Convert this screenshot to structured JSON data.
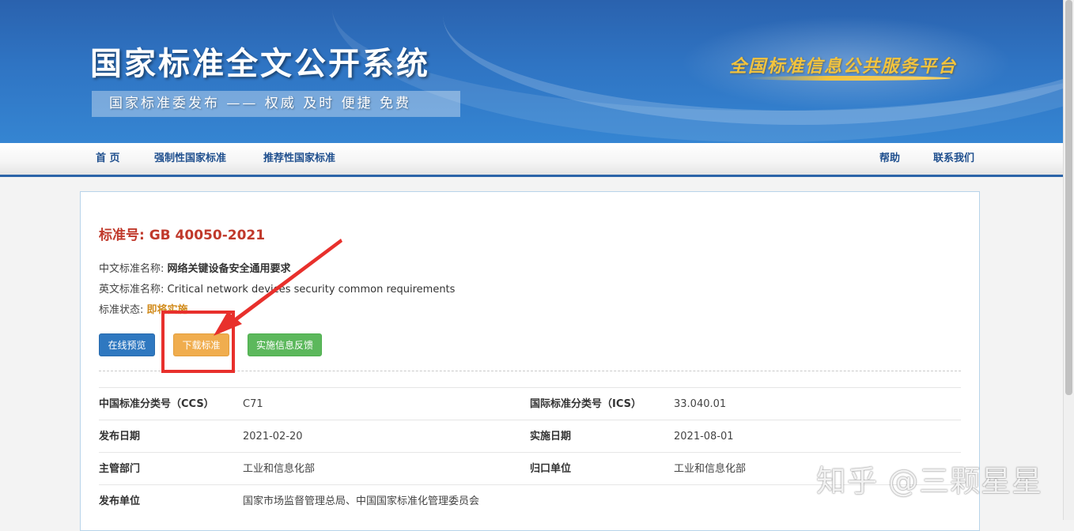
{
  "header": {
    "site_title": "国家标准全文公开系统",
    "subtitle": "国家标准委发布 —— 权威 及时 便捷 免费",
    "slogan": "全国标准信息公共服务平台"
  },
  "nav": {
    "home": "首 页",
    "mandatory": "强制性国家标准",
    "recommended": "推荐性国家标准",
    "help": "帮助",
    "contact": "联系我们"
  },
  "standard": {
    "number_label": "标准号: ",
    "number": "GB 40050-2021",
    "cn_name_label": "中文标准名称: ",
    "cn_name": "网络关键设备安全通用要求",
    "en_name_label": "英文标准名称: ",
    "en_name": "Critical network devices security common requirements",
    "status_label": "标准状态: ",
    "status": "即将实施"
  },
  "buttons": {
    "preview": "在线预览",
    "download": "下载标准",
    "feedback": "实施信息反馈"
  },
  "details": [
    {
      "k1": "中国标准分类号（CCS）",
      "v1": "C71",
      "k2": "国际标准分类号（ICS）",
      "v2": "33.040.01"
    },
    {
      "k1": "发布日期",
      "v1": "2021-02-20",
      "k2": "实施日期",
      "v2": "2021-08-01"
    },
    {
      "k1": "主管部门",
      "v1": "工业和信息化部",
      "k2": "归口单位",
      "v2": "工业和信息化部"
    },
    {
      "k1": "发布单位",
      "v1": "国家市场监督管理总局、中国国家标准化管理委员会",
      "k2": "",
      "v2": ""
    }
  ],
  "watermark": "知乎 @三颗星星",
  "colors": {
    "brand_blue": "#2f74c3",
    "title_red": "#c0392b",
    "annotation_red": "#e8302c",
    "btn_blue": "#2f78c0",
    "btn_orange": "#f0ad4e",
    "btn_green": "#5cb85c",
    "status_orange": "#d18b1c"
  }
}
